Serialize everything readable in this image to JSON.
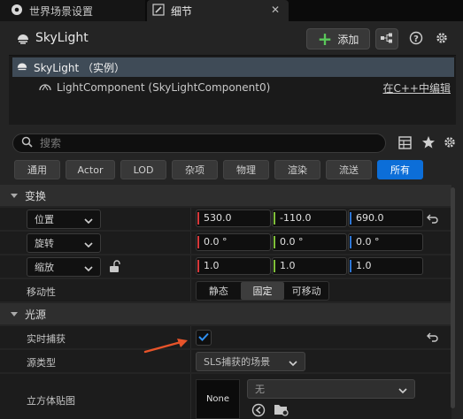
{
  "tabs": [
    {
      "label": "世界场景设置",
      "icon": "world-settings-icon"
    },
    {
      "label": "细节",
      "icon": "pencil-icon"
    }
  ],
  "header": {
    "title": "SkyLight",
    "add_label": "添加"
  },
  "tree": {
    "root_label": "SkyLight （实例）",
    "child_label": "LightComponent (SkyLightComponent0)",
    "edit_link": "在C++中编辑"
  },
  "search": {
    "placeholder": "搜索"
  },
  "filters": [
    "通用",
    "Actor",
    "LOD",
    "杂项",
    "物理",
    "渲染",
    "流送",
    "所有"
  ],
  "active_filter": "所有",
  "sections": {
    "transform": {
      "title": "变换",
      "location": {
        "label": "位置",
        "x": "530.0",
        "y": "-110.0",
        "z": "690.0"
      },
      "rotation": {
        "label": "旋转",
        "x": "0.0 °",
        "y": "0.0 °",
        "z": "0.0 °"
      },
      "scale": {
        "label": "缩放",
        "x": "1.0",
        "y": "1.0",
        "z": "1.0"
      },
      "mobility": {
        "label": "移动性",
        "options": [
          "静态",
          "固定",
          "可移动"
        ],
        "selected": "固定"
      }
    },
    "light": {
      "title": "光源",
      "realtime_capture": {
        "label": "实时捕获",
        "checked": true
      },
      "source_type": {
        "label": "源类型",
        "value": "SLS捕获的场景"
      },
      "cubemap": {
        "label": "立方体贴图",
        "thumb": "None",
        "value": "无"
      }
    }
  },
  "colors": {
    "accent": "#0c6ed8",
    "axis_x": "#d8383a",
    "axis_y": "#7fbf3a",
    "axis_z": "#2d76d6",
    "annotation_arrow": "#e8542a"
  }
}
